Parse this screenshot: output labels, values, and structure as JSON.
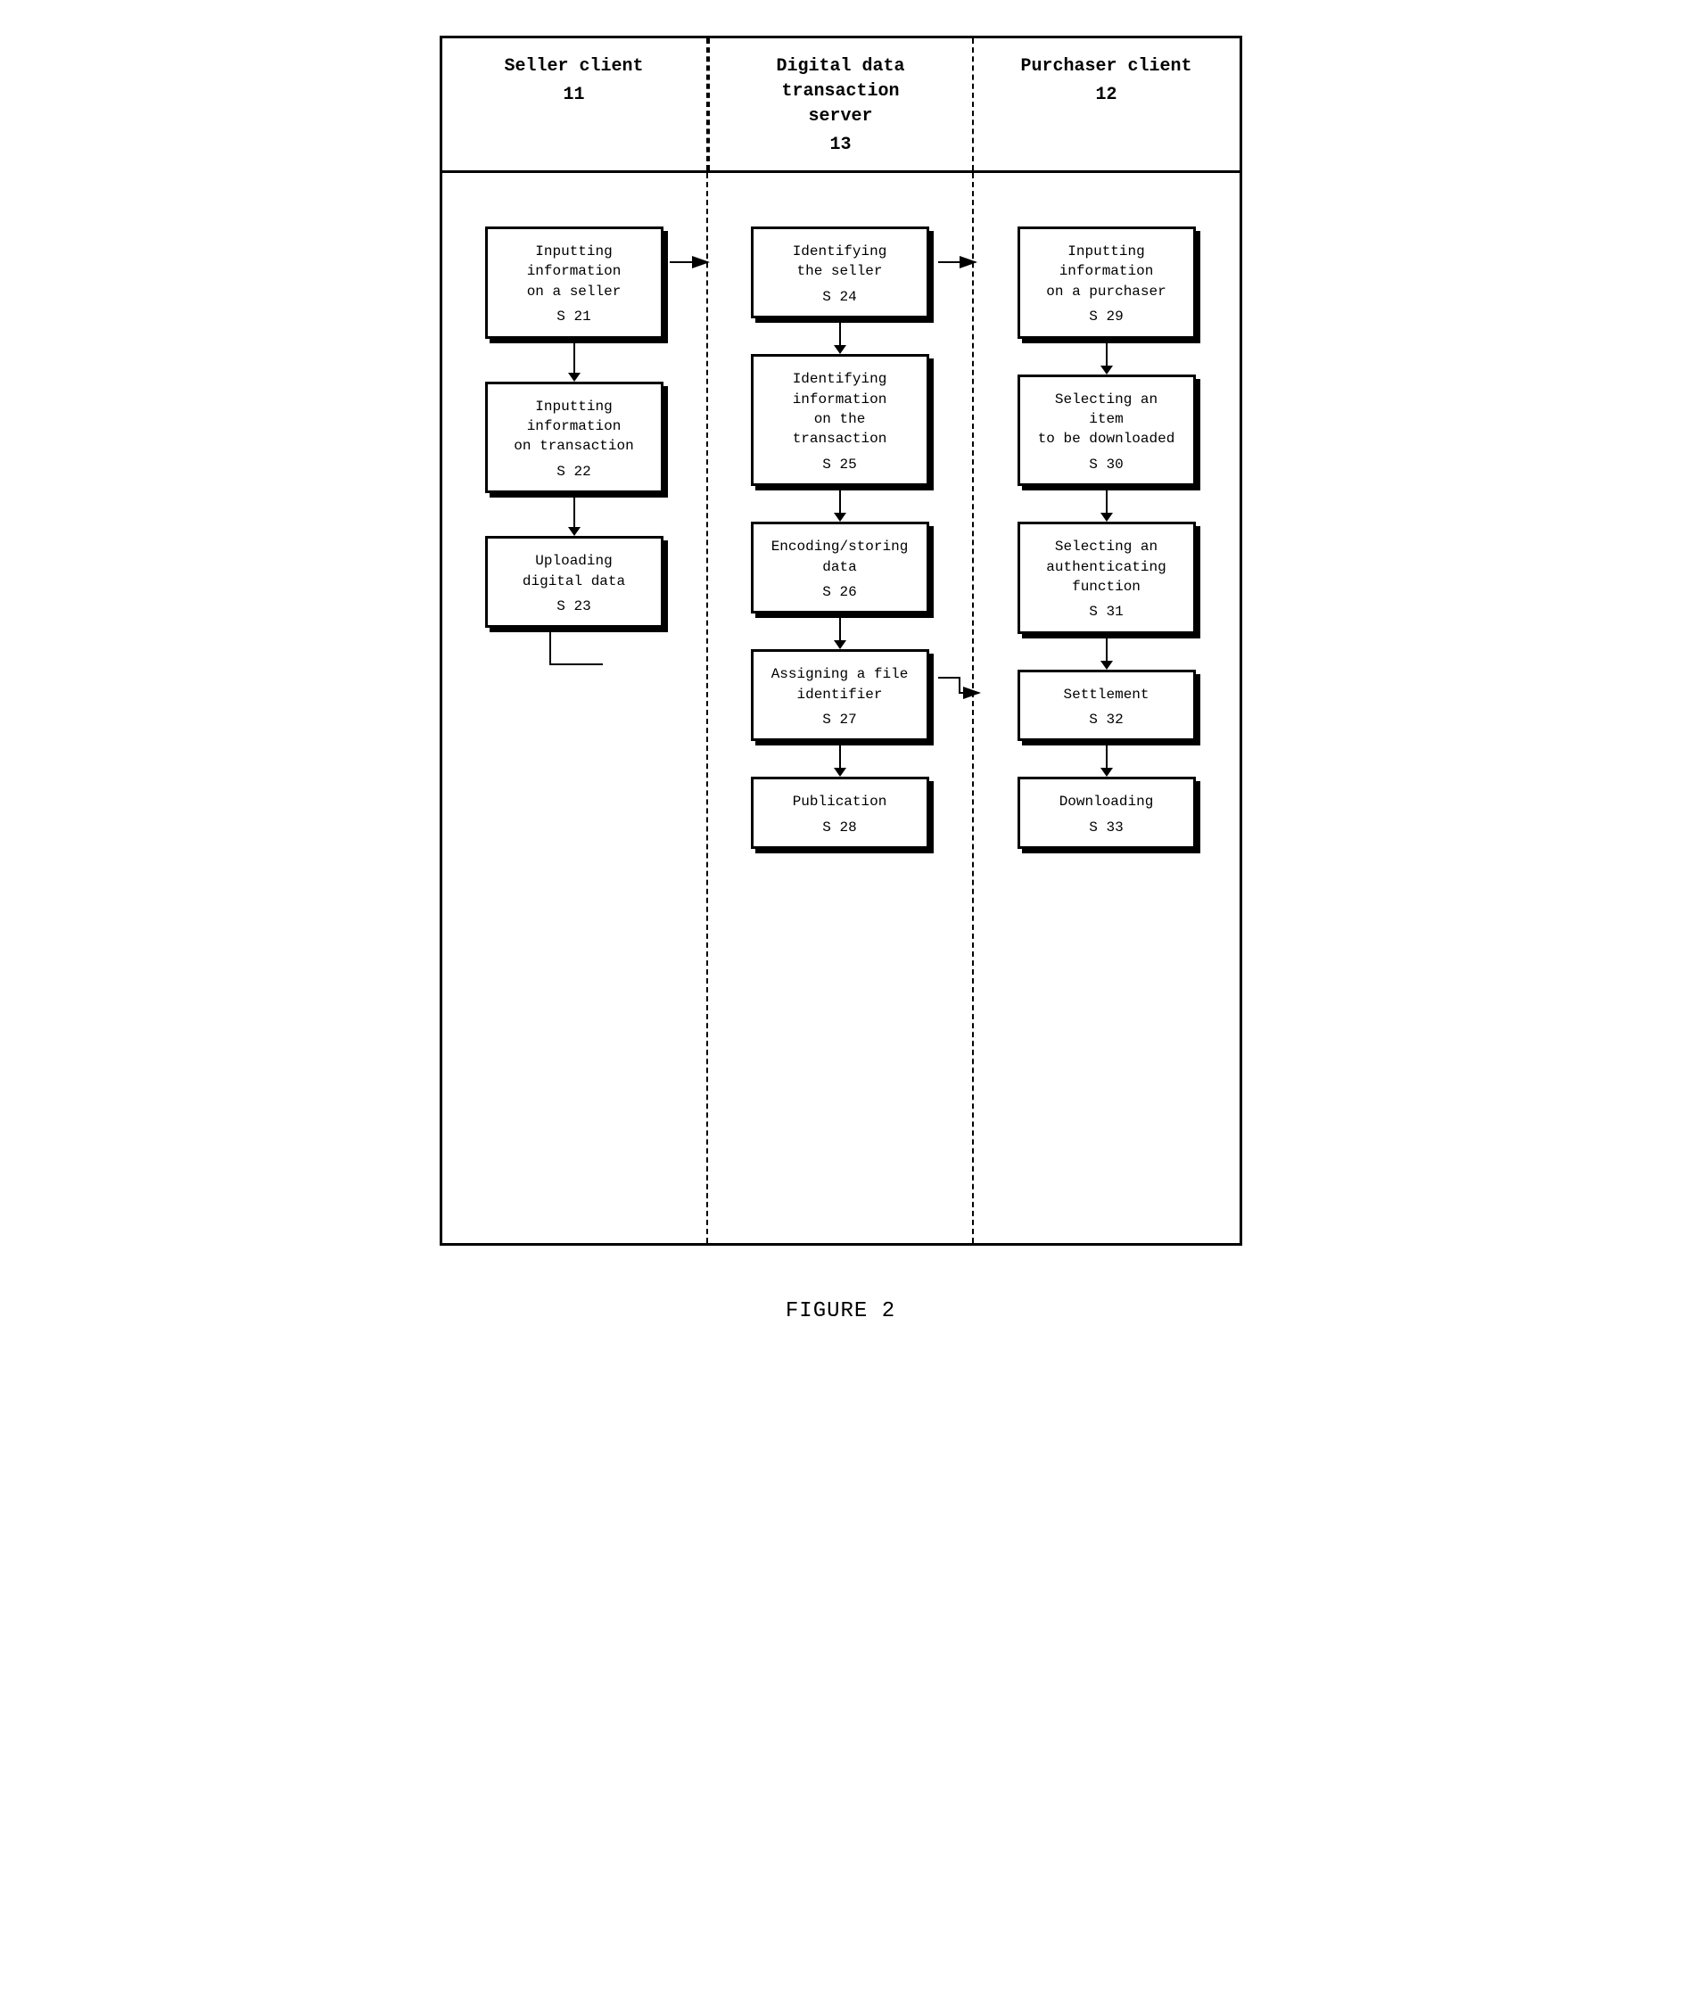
{
  "header": {
    "col1": {
      "title": "Seller client",
      "number": "11"
    },
    "col2": {
      "title": "Digital data\ntransaction\nserver",
      "number": "13"
    },
    "col3": {
      "title": "Purchaser client",
      "number": "12"
    }
  },
  "seller_steps": [
    {
      "id": "s21",
      "text": "Inputting information\non a seller",
      "step": "S 21"
    },
    {
      "id": "s22",
      "text": "Inputting information\non transaction",
      "step": "S 22"
    },
    {
      "id": "s23",
      "text": "Uploading\ndigital data",
      "step": "S 23"
    }
  ],
  "server_steps": [
    {
      "id": "s24",
      "text": "Identifying\nthe seller",
      "step": "S 24"
    },
    {
      "id": "s25",
      "text": "Identifying information\non the transaction",
      "step": "S 25"
    },
    {
      "id": "s26",
      "text": "Encoding/storing\ndata",
      "step": "S 26"
    },
    {
      "id": "s27",
      "text": "Assigning a file\nidentifier",
      "step": "S 27"
    },
    {
      "id": "s28",
      "text": "Publication",
      "step": "S 28"
    }
  ],
  "purchaser_steps": [
    {
      "id": "s29",
      "text": "Inputting information\non a purchaser",
      "step": "S 29"
    },
    {
      "id": "s30",
      "text": "Selecting an item\nto be downloaded",
      "step": "S 30"
    },
    {
      "id": "s31",
      "text": "Selecting an\nauthenticating\nfunction",
      "step": "S 31"
    },
    {
      "id": "s32",
      "text": "Settlement",
      "step": "S 32"
    },
    {
      "id": "s33",
      "text": "Downloading",
      "step": "S 33"
    }
  ],
  "figure_caption": "FIGURE 2"
}
